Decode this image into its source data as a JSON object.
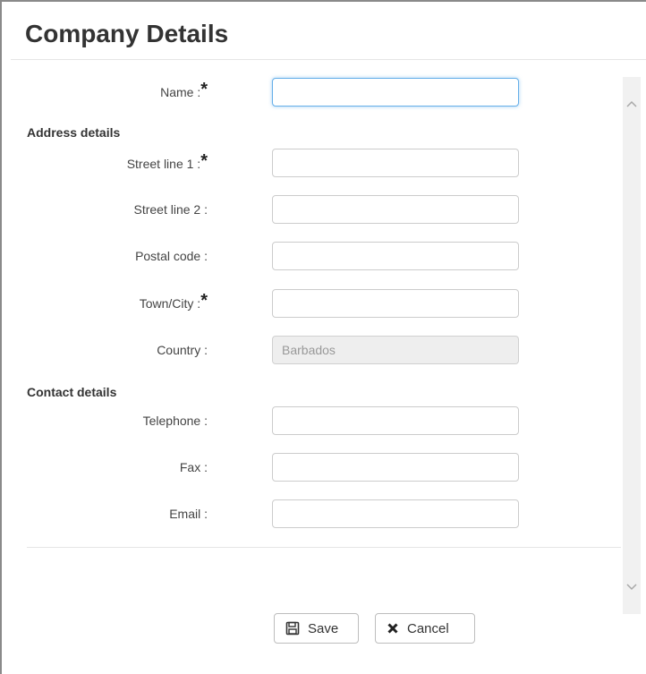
{
  "dialog": {
    "title": "Company Details"
  },
  "form": {
    "name": {
      "label": "Name :",
      "required": "*",
      "value": ""
    },
    "address_heading": "Address details",
    "street1": {
      "label": "Street line 1 :",
      "required": "*",
      "value": ""
    },
    "street2": {
      "label": "Street line 2 :",
      "value": ""
    },
    "postal": {
      "label": "Postal code :",
      "value": ""
    },
    "town": {
      "label": "Town/City :",
      "required": "*",
      "value": ""
    },
    "country": {
      "label": "Country :",
      "value": "Barbados"
    },
    "contact_heading": "Contact details",
    "telephone": {
      "label": "Telephone :",
      "value": ""
    },
    "fax": {
      "label": "Fax :",
      "value": ""
    },
    "email": {
      "label": "Email :",
      "value": ""
    }
  },
  "buttons": {
    "save": {
      "label": "Save",
      "icon": "floppy-disk-icon"
    },
    "cancel": {
      "label": "Cancel",
      "icon": "close-icon"
    }
  },
  "colors": {
    "focus_border": "#66afe9",
    "readonly_bg": "#eeeeee"
  }
}
